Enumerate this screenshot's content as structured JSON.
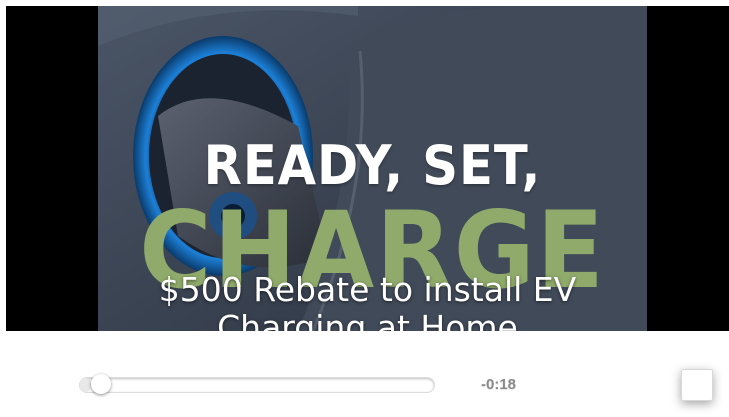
{
  "video": {
    "headline": "READY, SET,",
    "big_word": "CHARGE",
    "caption_line1": "$500 Rebate to install EV",
    "caption_line2": "Charging at Home"
  },
  "controls": {
    "time_remaining": "-0:18",
    "progress": 0.03
  },
  "colors": {
    "headline": "#ffffff",
    "big_word": "#8faa6a",
    "frame_background": "#000000",
    "controls_background": "#ffffff"
  },
  "icons": {
    "fullscreen": "square-button-icon"
  }
}
